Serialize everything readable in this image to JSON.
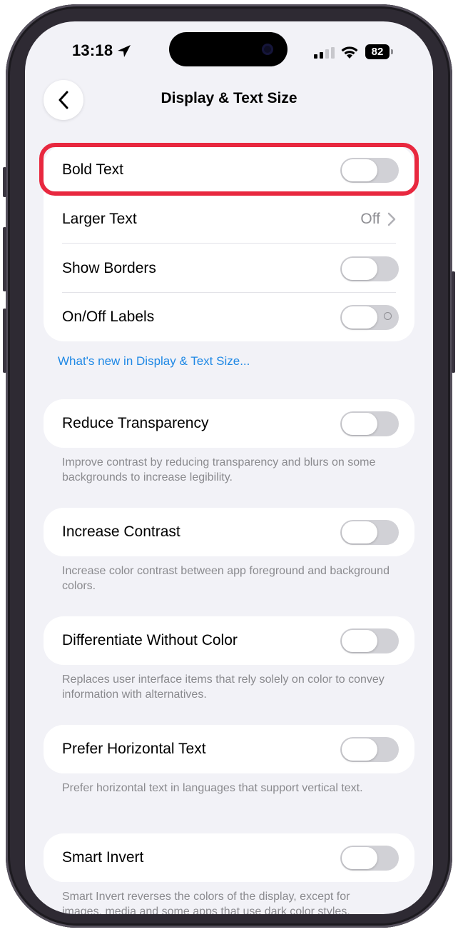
{
  "status_bar": {
    "time": "13:18",
    "battery": "82"
  },
  "nav": {
    "title": "Display & Text Size"
  },
  "group1": {
    "bold_text": "Bold Text",
    "larger_text": "Larger Text",
    "larger_text_value": "Off",
    "show_borders": "Show Borders",
    "onoff_labels": "On/Off Labels"
  },
  "whats_new_link": "What's new in Display & Text Size...",
  "reduce_transparency": {
    "label": "Reduce Transparency",
    "footnote": "Improve contrast by reducing transparency and blurs on some backgrounds to increase legibility."
  },
  "increase_contrast": {
    "label": "Increase Contrast",
    "footnote": "Increase color contrast between app foreground and background colors."
  },
  "differentiate": {
    "label": "Differentiate Without Color",
    "footnote": "Replaces user interface items that rely solely on color to convey information with alternatives."
  },
  "prefer_horizontal": {
    "label": "Prefer Horizontal Text",
    "footnote": "Prefer horizontal text in languages that support vertical text."
  },
  "smart_invert": {
    "label": "Smart Invert",
    "footnote": "Smart Invert reverses the colors of the display, except for images, media and some apps that use dark color styles."
  },
  "toggles": {
    "bold_text": false,
    "show_borders": false,
    "onoff_labels": false,
    "reduce_transparency": false,
    "increase_contrast": false,
    "differentiate": false,
    "prefer_horizontal": false,
    "smart_invert": false
  },
  "colors": {
    "highlight": "#e8283f",
    "link": "#1e88e5",
    "background": "#f2f2f7"
  }
}
